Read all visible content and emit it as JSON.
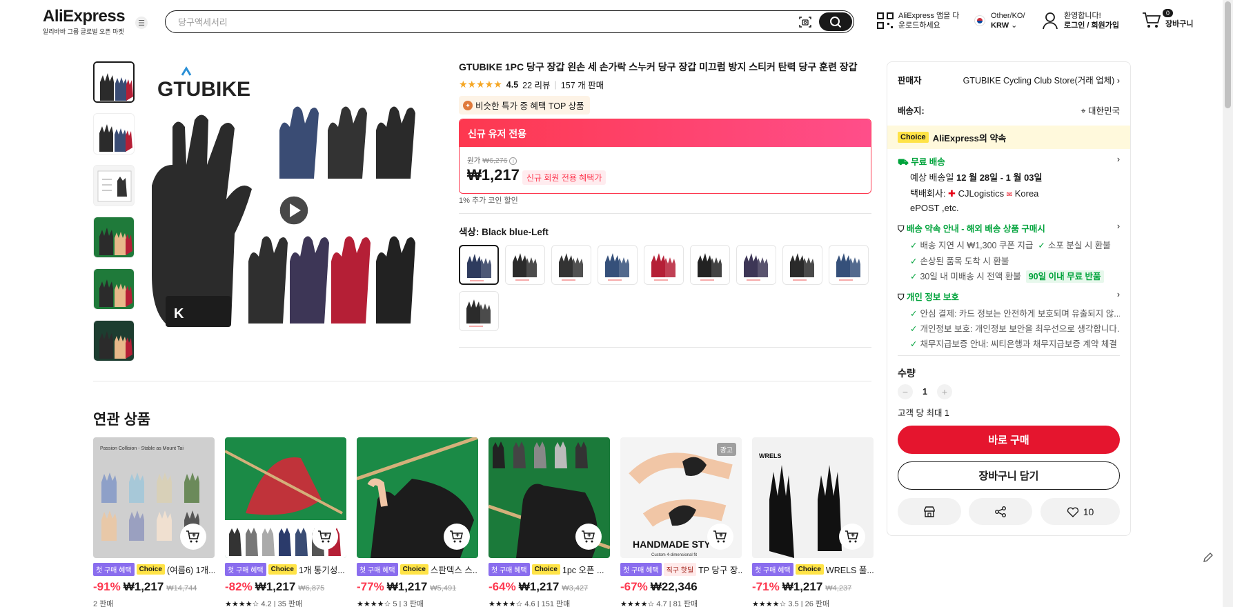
{
  "header": {
    "logo": "AliExpress",
    "logo_sub": "알리바바 그룹 글로벌 오픈 마켓",
    "search_placeholder": "당구액세서리",
    "app_line1": "AliExpress 앱을 다",
    "app_line2": "운로드하세요",
    "region_line1": "Other/KO/",
    "region_line2": "KRW",
    "user_line1": "환영합니다!",
    "user_line2": "로그인 / 회원가입",
    "cart_count": "0",
    "cart_label": "장바구니"
  },
  "product": {
    "title": "GTUBIKE 1PC 당구 장갑 왼손 세 손가락 스누커 당구 장갑 미끄럼 방지 스티커 탄력 당구 훈련 장갑",
    "brand_text": "GTUBIKE",
    "rating": "4.5",
    "rating_value": 4.5,
    "reviews": "22 리뷰",
    "sold": "157 개 판매",
    "top_badge": "비슷한 특가 중 혜택 TOP 상품",
    "promo_header": "신규 유저 전용",
    "orig_label": "원가",
    "orig_price": "₩6,276",
    "price": "₩1,217",
    "new_member_tag": "신규 회원 전용 혜택가",
    "coin_text": "1% 추가 코인 할인",
    "color_label": "색상:",
    "color_value": "Black blue-Left",
    "swatch_count": 10,
    "thumb_count": 6
  },
  "related": {
    "title": "연관 상품",
    "items": [
      {
        "badge": "첫 구매 혜택",
        "tag": "Choice",
        "name": "(여름6) 1개...",
        "discount": "-91%",
        "price": "₩1,217",
        "orig": "₩14,744",
        "sold": "2 판매",
        "img_caption": "Passion Collision - Stable as Mount Tai",
        "ad": ""
      },
      {
        "badge": "첫 구매 혜택",
        "tag": "Choice",
        "name": "1개 통기성...",
        "discount": "-82%",
        "price": "₩1,217",
        "orig": "₩6,875",
        "sold": "4.2 | 35 판매",
        "img_caption": "",
        "ad": ""
      },
      {
        "badge": "첫 구매 혜택",
        "tag": "Choice",
        "name": "스판덱스 스...",
        "discount": "-77%",
        "price": "₩1,217",
        "orig": "₩5,491",
        "sold": "5 | 3 판매",
        "img_caption": "",
        "ad": ""
      },
      {
        "badge": "첫 구매 혜택",
        "tag": "Choice",
        "name": "1pc 오픈 ...",
        "discount": "-64%",
        "price": "₩1,217",
        "orig": "₩3,427",
        "sold": "4.6 | 151 판매",
        "img_caption": "",
        "ad": ""
      },
      {
        "badge": "첫 구매 혜택",
        "tag": "직구 핫딜",
        "name": "TP 당구 장...",
        "discount": "-67%",
        "price": "₩22,346",
        "orig": "",
        "sold": "4.7 | 81 판매",
        "img_caption": "HANDMADE STY",
        "ad": "광고"
      },
      {
        "badge": "첫 구매 혜택",
        "tag": "Choice",
        "name": "WRELS 풀...",
        "discount": "-71%",
        "price": "₩1,217",
        "orig": "₩4,237",
        "sold": "3.5 | 26 판매",
        "img_caption": "WRELS",
        "ad": ""
      }
    ]
  },
  "panel": {
    "seller_label": "판매자",
    "seller_name": "GTUBIKE Cycling Club Store(거래 업체)",
    "ship_label": "배송지:",
    "ship_to": "대한민국",
    "choice_tag": "Choice",
    "choice_title": "AliExpress의 약속",
    "free_ship": "무료 배송",
    "eta_label": "예상 배송일",
    "eta": "12 월 28일 - 1 월 03일",
    "courier_label": "택배회사:",
    "courier1": "CJLogistics",
    "courier2": "Korea",
    "courier3": "ePOST ,etc.",
    "promise_title": "배송 약속 안내 - 해외 배송 상품 구매시",
    "promise1": "배송 지연 시 ₩1,300 쿠폰 지급",
    "promise2": "소포 분실 시 환불",
    "promise3": "손상된 품목 도착 시 환불",
    "promise4": "30일 내 미배송 시 전액 환불",
    "promise4_badge": "90일 이내 무료 반품",
    "privacy_title": "개인 정보 보호",
    "privacy1": "안심 결제: 카드 정보는 안전하게 보호되며 유출되지 않...",
    "privacy2": "개인정보 보호: 개인정보 보안을 최우선으로 생각합니다.",
    "privacy3": "채무지급보증 안내: 씨티은행과 채무지급보증 계약 체결",
    "qty_label": "수량",
    "qty": "1",
    "max_label": "고객 당 최대 1",
    "buy_now": "바로 구매",
    "add_cart": "장바구니 담기",
    "wish_count": "10"
  },
  "colors": {
    "accent": "#fd384f",
    "dark": "#191919",
    "green": "#00a33b",
    "choice": "#ffe346",
    "buy": "#e5152e"
  }
}
